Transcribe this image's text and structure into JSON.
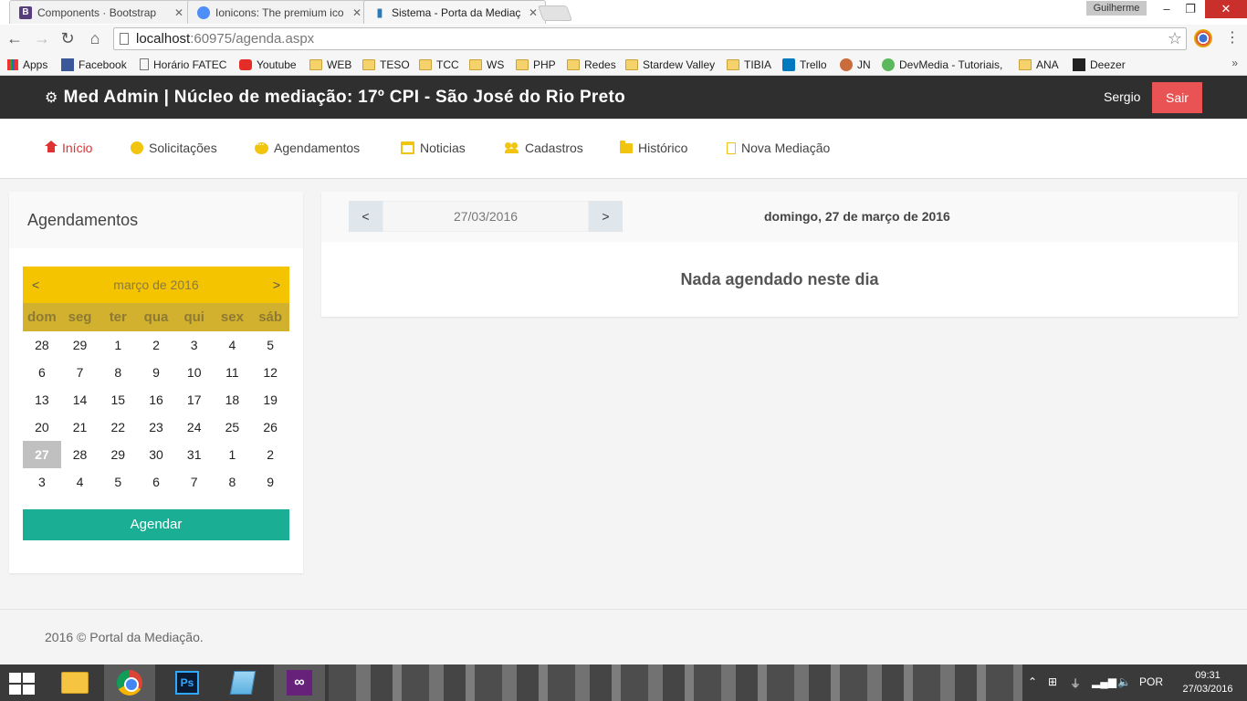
{
  "browser": {
    "tabs": [
      {
        "title": "Components · Bootstrap",
        "favicon": "B",
        "favicon_color": "#563d7c"
      },
      {
        "title": "Ionicons: The premium ico",
        "favicon": "",
        "favicon_color": "#4e8ef7"
      },
      {
        "title": "Sistema - Porta da Mediaç",
        "favicon": "",
        "favicon_color": "#2a7ab8"
      }
    ],
    "user_chip": "Guilherme",
    "address": {
      "host": "localhost",
      "path": ":60975/agenda.aspx"
    },
    "bookmarks": [
      {
        "label": "Apps",
        "icon": "apps-grid-icon"
      },
      {
        "label": "Facebook",
        "icon": "facebook-icon"
      },
      {
        "label": "Horário FATEC",
        "icon": "page-icon"
      },
      {
        "label": "Youtube",
        "icon": "youtube-icon"
      },
      {
        "label": "WEB",
        "icon": "folder-icon"
      },
      {
        "label": "TESO",
        "icon": "folder-icon"
      },
      {
        "label": "TCC",
        "icon": "folder-icon"
      },
      {
        "label": "WS",
        "icon": "folder-icon"
      },
      {
        "label": "PHP",
        "icon": "folder-icon"
      },
      {
        "label": "Redes",
        "icon": "folder-icon"
      },
      {
        "label": "Stardew Valley",
        "icon": "folder-icon"
      },
      {
        "label": "TIBIA",
        "icon": "folder-icon"
      },
      {
        "label": "Trello",
        "icon": "trello-icon"
      },
      {
        "label": "JN",
        "icon": "jn-icon"
      },
      {
        "label": "DevMedia - Tutoriais,",
        "icon": "devmedia-icon"
      },
      {
        "label": "ANA",
        "icon": "folder-icon"
      },
      {
        "label": "Deezer",
        "icon": "deezer-icon"
      }
    ],
    "bookmarks_more": "»"
  },
  "header": {
    "title": "Med Admin | Núcleo de mediação: 17º CPI - São José do Rio Preto",
    "user": "Sergio",
    "logout_label": "Sair"
  },
  "nav": {
    "items": [
      {
        "label": "Início",
        "icon": "home-icon",
        "active": true
      },
      {
        "label": "Solicitações",
        "icon": "circle-icon"
      },
      {
        "label": "Agendamentos",
        "icon": "chat-icon"
      },
      {
        "label": "Noticias",
        "icon": "calendar-icon"
      },
      {
        "label": "Cadastros",
        "icon": "users-icon"
      },
      {
        "label": "Histórico",
        "icon": "folder-icon"
      },
      {
        "label": "Nova Mediação",
        "icon": "file-icon"
      }
    ]
  },
  "sidebar": {
    "title": "Agendamentos",
    "calendar": {
      "prev": "<",
      "next": ">",
      "month_label": "março de 2016",
      "weekdays": [
        "dom",
        "seg",
        "ter",
        "qua",
        "qui",
        "sex",
        "sáb"
      ],
      "days": [
        [
          "28",
          "29",
          "1",
          "2",
          "3",
          "4",
          "5"
        ],
        [
          "6",
          "7",
          "8",
          "9",
          "10",
          "11",
          "12"
        ],
        [
          "13",
          "14",
          "15",
          "16",
          "17",
          "18",
          "19"
        ],
        [
          "20",
          "21",
          "22",
          "23",
          "24",
          "25",
          "26"
        ],
        [
          "27",
          "28",
          "29",
          "30",
          "31",
          "1",
          "2"
        ],
        [
          "3",
          "4",
          "5",
          "6",
          "7",
          "8",
          "9"
        ]
      ],
      "selected_day": "27"
    },
    "schedule_button": "Agendar"
  },
  "agenda": {
    "prev": "<",
    "next": ">",
    "date_value": "27/03/2016",
    "date_long": "domingo, 27 de março de 2016",
    "empty_message": "Nada agendado neste dia"
  },
  "footer": {
    "text": "2016 © Portal da Mediação."
  },
  "taskbar": {
    "language": "POR",
    "time": "09:31",
    "date": "27/03/2016"
  }
}
